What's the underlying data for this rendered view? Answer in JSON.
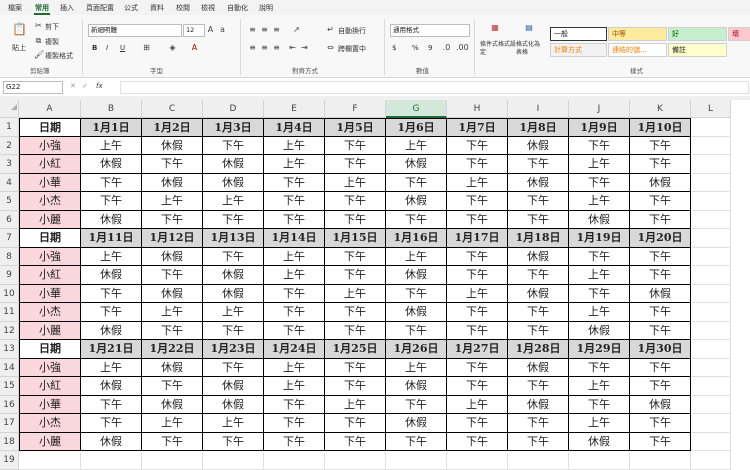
{
  "ribbon": {
    "tabs": [
      "檔案",
      "常用",
      "插入",
      "頁面配置",
      "公式",
      "資料",
      "校閱",
      "檢視",
      "自動化",
      "說明"
    ],
    "active_tab": "常用",
    "clipboard": {
      "paste": "貼上",
      "cut": "剪下",
      "copy": "複製",
      "format_painter": "複製格式",
      "group": "剪貼簿"
    },
    "font": {
      "name": "新細明體",
      "size": "12",
      "group": "字型",
      "bold": "B",
      "italic": "I",
      "underline": "U"
    },
    "alignment": {
      "wrap": "自動換行",
      "merge": "跨欄置中",
      "group": "對齊方式"
    },
    "number": {
      "format": "通用格式",
      "currency": "$",
      "percent": "%",
      "comma": "9",
      "group": "數值"
    },
    "styles": {
      "conditional": "條件式格式設定",
      "table": "格式化為表格",
      "group": "樣式",
      "cells": [
        "一般",
        "中等",
        "好",
        "壞",
        "計算方式",
        "連結的儲...",
        "備註"
      ]
    }
  },
  "formula_bar": {
    "name_box": "G22",
    "fx": "fx",
    "value": ""
  },
  "column_headers": [
    "A",
    "B",
    "C",
    "D",
    "E",
    "F",
    "G",
    "H",
    "I",
    "J",
    "K",
    "L"
  ],
  "row_headers": [
    "1",
    "2",
    "3",
    "4",
    "5",
    "6",
    "7",
    "8",
    "9",
    "10",
    "11",
    "12",
    "13",
    "14",
    "15",
    "16",
    "17",
    "18",
    "19"
  ],
  "selected_column": "G",
  "sheet": {
    "rows": [
      [
        "日期",
        "1月1日",
        "1月2日",
        "1月3日",
        "1月4日",
        "1月5日",
        "1月6日",
        "1月7日",
        "1月8日",
        "1月9日",
        "1月10日"
      ],
      [
        "小強",
        "上午",
        "休假",
        "下午",
        "上午",
        "下午",
        "上午",
        "下午",
        "休假",
        "下午",
        "下午"
      ],
      [
        "小紅",
        "休假",
        "下午",
        "休假",
        "上午",
        "下午",
        "休假",
        "下午",
        "下午",
        "上午",
        "下午"
      ],
      [
        "小華",
        "下午",
        "休假",
        "休假",
        "下午",
        "上午",
        "下午",
        "上午",
        "休假",
        "下午",
        "休假"
      ],
      [
        "小杰",
        "下午",
        "上午",
        "上午",
        "下午",
        "下午",
        "休假",
        "下午",
        "下午",
        "上午",
        "下午"
      ],
      [
        "小麗",
        "休假",
        "下午",
        "下午",
        "下午",
        "下午",
        "下午",
        "下午",
        "下午",
        "休假",
        "下午"
      ],
      [
        "日期",
        "1月11日",
        "1月12日",
        "1月13日",
        "1月14日",
        "1月15日",
        "1月16日",
        "1月17日",
        "1月18日",
        "1月19日",
        "1月20日"
      ],
      [
        "小強",
        "上午",
        "休假",
        "下午",
        "上午",
        "下午",
        "上午",
        "下午",
        "休假",
        "下午",
        "下午"
      ],
      [
        "小紅",
        "休假",
        "下午",
        "休假",
        "上午",
        "下午",
        "休假",
        "下午",
        "下午",
        "上午",
        "下午"
      ],
      [
        "小華",
        "下午",
        "休假",
        "休假",
        "下午",
        "上午",
        "下午",
        "上午",
        "休假",
        "下午",
        "休假"
      ],
      [
        "小杰",
        "下午",
        "上午",
        "上午",
        "下午",
        "下午",
        "休假",
        "下午",
        "下午",
        "上午",
        "下午"
      ],
      [
        "小麗",
        "休假",
        "下午",
        "下午",
        "下午",
        "下午",
        "下午",
        "下午",
        "下午",
        "休假",
        "下午"
      ],
      [
        "日期",
        "1月21日",
        "1月22日",
        "1月23日",
        "1月24日",
        "1月25日",
        "1月26日",
        "1月27日",
        "1月28日",
        "1月29日",
        "1月30日"
      ],
      [
        "小強",
        "上午",
        "休假",
        "下午",
        "上午",
        "下午",
        "上午",
        "下午",
        "休假",
        "下午",
        "下午"
      ],
      [
        "小紅",
        "休假",
        "下午",
        "休假",
        "上午",
        "下午",
        "休假",
        "下午",
        "下午",
        "上午",
        "下午"
      ],
      [
        "小華",
        "下午",
        "休假",
        "休假",
        "下午",
        "上午",
        "下午",
        "上午",
        "休假",
        "下午",
        "休假"
      ],
      [
        "小杰",
        "下午",
        "上午",
        "上午",
        "下午",
        "下午",
        "休假",
        "下午",
        "下午",
        "上午",
        "下午"
      ],
      [
        "小麗",
        "休假",
        "下午",
        "下午",
        "下午",
        "下午",
        "下午",
        "下午",
        "下午",
        "休假",
        "下午"
      ]
    ]
  },
  "colors": {
    "accent": "#1e6b34",
    "name_fill": "#fad7dd",
    "date_row_fill": "#d8d8d8"
  }
}
